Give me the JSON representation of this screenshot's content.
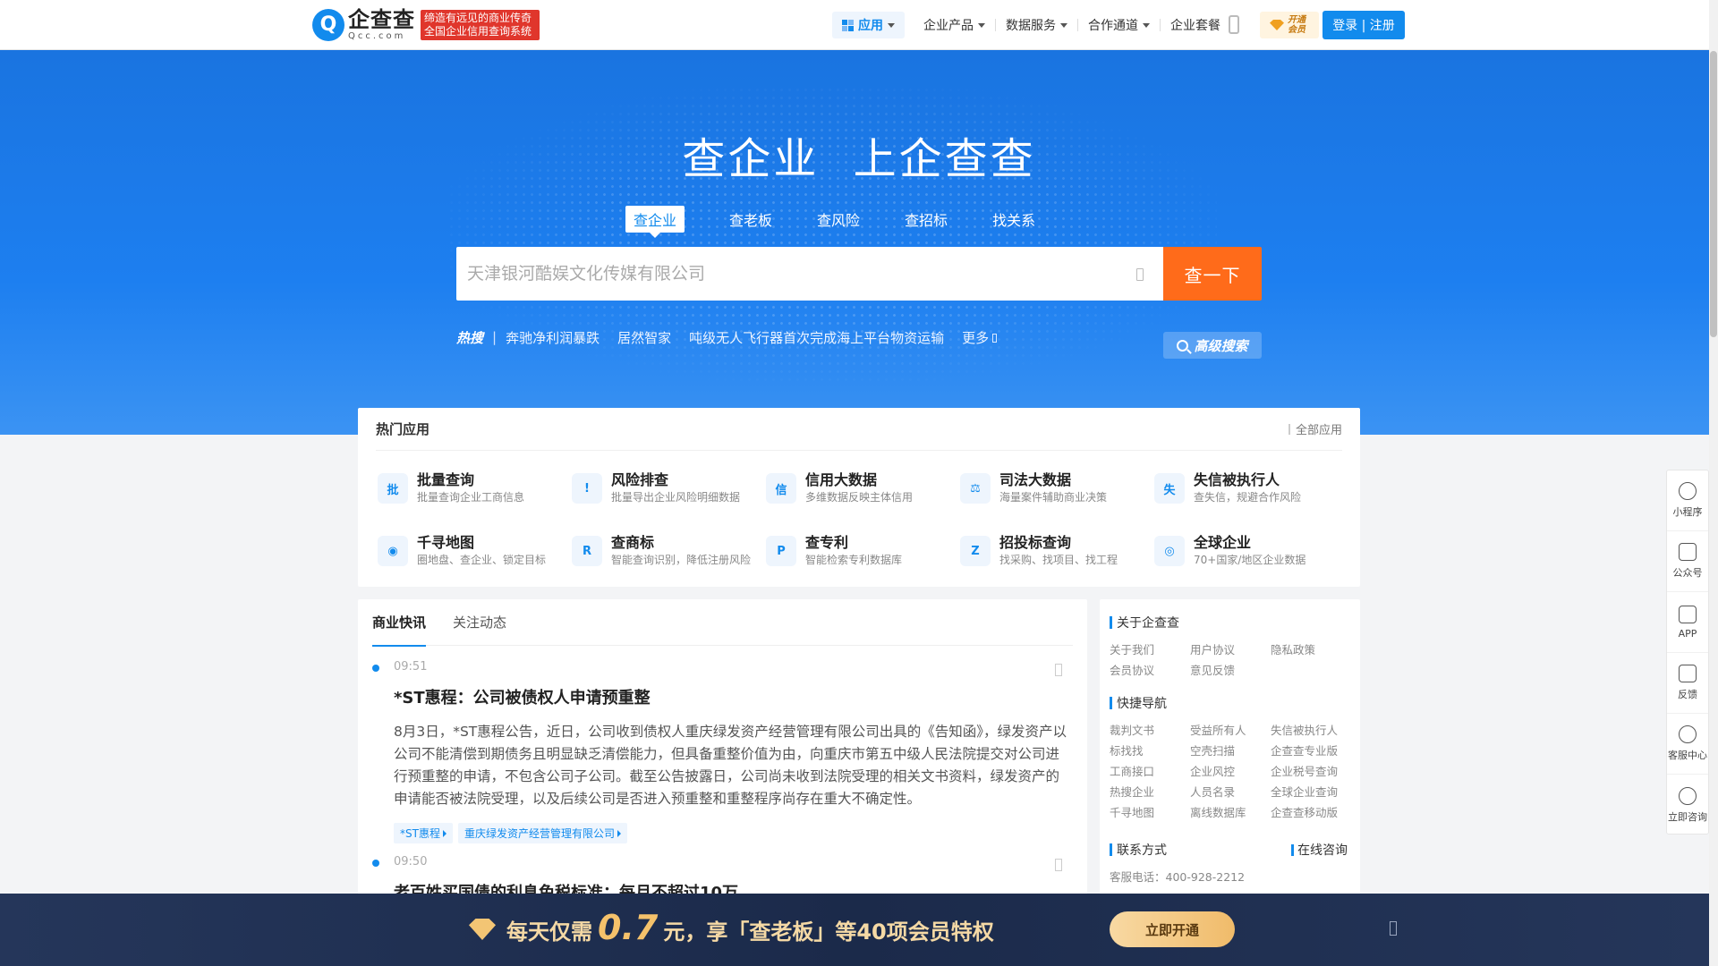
{
  "nav": {
    "logo_cn": "企查查",
    "logo_en": "Qcc.com",
    "slogan": "缔造有远见的商业传奇 全国企业信用查询系统",
    "items": [
      {
        "label": "应用",
        "has_caret": true,
        "active": true
      },
      {
        "label": "企业产品",
        "has_caret": true
      },
      {
        "label": "数据服务",
        "has_caret": true
      },
      {
        "label": "合作通道",
        "has_caret": true
      },
      {
        "label": "企业套餐",
        "has_caret": false
      }
    ],
    "vip_label": "开通会员",
    "login_label": "登录 | 注册"
  },
  "hero": {
    "title": "查企业 上企查查",
    "tabs": [
      "查企业",
      "查老板",
      "查风险",
      "查招标",
      "找关系"
    ],
    "active_tab": 0,
    "search_placeholder": "天津银河酷娱文化传媒有限公司",
    "search_button": "查一下",
    "hot_label": "热搜",
    "hot_bar": "|",
    "hot_items": [
      "奔驰净利润暴跌",
      "居然智家",
      "吨级无人飞行器首次完成海上平台物资运输"
    ],
    "more_label": "更多",
    "advanced_search": "高级搜索"
  },
  "apps": {
    "title": "热门应用",
    "all_label": "全部应用",
    "items": [
      {
        "name": "批量查询",
        "desc": "批量查询企业工商信息",
        "icon": "batch-search-icon",
        "glyph": "批"
      },
      {
        "name": "风险排查",
        "desc": "批量导出企业风险明细数据",
        "icon": "risk-warning-icon",
        "glyph": "!"
      },
      {
        "name": "信用大数据",
        "desc": "多维数据反映主体信用",
        "icon": "credit-data-icon",
        "glyph": "信"
      },
      {
        "name": "司法大数据",
        "desc": "海量案件辅助商业决策",
        "icon": "judicial-scale-icon",
        "glyph": "⚖"
      },
      {
        "name": "失信被执行人",
        "desc": "查失信，规避合作风险",
        "icon": "dishonest-list-icon",
        "glyph": "失"
      },
      {
        "name": "千寻地图",
        "desc": "圈地盘、查企业、锁定目标",
        "icon": "map-pin-icon",
        "glyph": "◉"
      },
      {
        "name": "查商标",
        "desc": "智能查询识别，降低注册风险",
        "icon": "trademark-icon",
        "glyph": "R"
      },
      {
        "name": "查专利",
        "desc": "智能检索专利数据库",
        "icon": "patent-icon",
        "glyph": "P"
      },
      {
        "name": "招投标查询",
        "desc": "找采购、找项目、找工程",
        "icon": "bidding-icon",
        "glyph": "Z"
      },
      {
        "name": "全球企业",
        "desc": "70+国家/地区企业数据",
        "icon": "globe-icon",
        "glyph": "◎"
      }
    ]
  },
  "news": {
    "tabs": [
      "商业快讯",
      "关注动态"
    ],
    "items": [
      {
        "time": "09:51",
        "title": "*ST惠程：公司被债权人申请预重整",
        "body": "8月3日，*ST惠程公告，近日，公司收到债权人重庆绿发资产经营管理有限公司出具的《告知函》，绿发资产以公司不能清偿到期债务且明显缺乏清偿能力，但具备重整价值为由，向重庆市第五中级人民法院提交对公司进行预重整的申请，不包含公司子公司。截至公告披露日，公司尚未收到法院受理的相关文书资料，绿发资产的申请能否被法院受理，以及后续公司是否进入预重整和重整程序尚存在重大不确定性。",
        "tags": [
          "*ST惠程",
          "重庆绿发资产经营管理有限公司"
        ]
      },
      {
        "time": "09:50",
        "title": "老百姓买国债的利息免税标准：每月不超过10万",
        "body": "",
        "tags": []
      }
    ]
  },
  "sidebar": {
    "about_title": "关于企查查",
    "about_links": [
      "关于我们",
      "用户协议",
      "隐私政策",
      "会员协议",
      "意见反馈"
    ],
    "quick_title": "快捷导航",
    "quick_links": [
      "裁判文书",
      "受益所有人",
      "失信被执行人",
      "标找找",
      "空壳扫描",
      "企查查专业版",
      "工商接口",
      "企业风控",
      "企业税号查询",
      "热搜企业",
      "人员名录",
      "全球企业查询",
      "千寻地图",
      "离线数据库",
      "企查查移动版"
    ],
    "contact_title": "联系方式",
    "online_label": "在线咨询",
    "phone": "客服电话：400-928-2212"
  },
  "float_bar": [
    {
      "label": "小程序",
      "icon": "mini-program-icon"
    },
    {
      "label": "公众号",
      "icon": "official-account-icon"
    },
    {
      "label": "APP",
      "icon": "mobile-app-icon"
    },
    {
      "label": "反馈",
      "icon": "feedback-icon"
    },
    {
      "label": "客服中心",
      "icon": "headset-icon"
    },
    {
      "label": "立即咨询",
      "icon": "chat-bubble-icon"
    }
  ],
  "promo": {
    "prefix": "每天仅需",
    "price": "0.7",
    "suffix": "元，享「查老板」等40项会员特权",
    "button": "立即开通"
  },
  "colors": {
    "brand_blue": "#128bed",
    "search_orange": "#ff6b1a",
    "promo_bg": "#1b2a4a",
    "promo_gold": "#f5c26b"
  }
}
